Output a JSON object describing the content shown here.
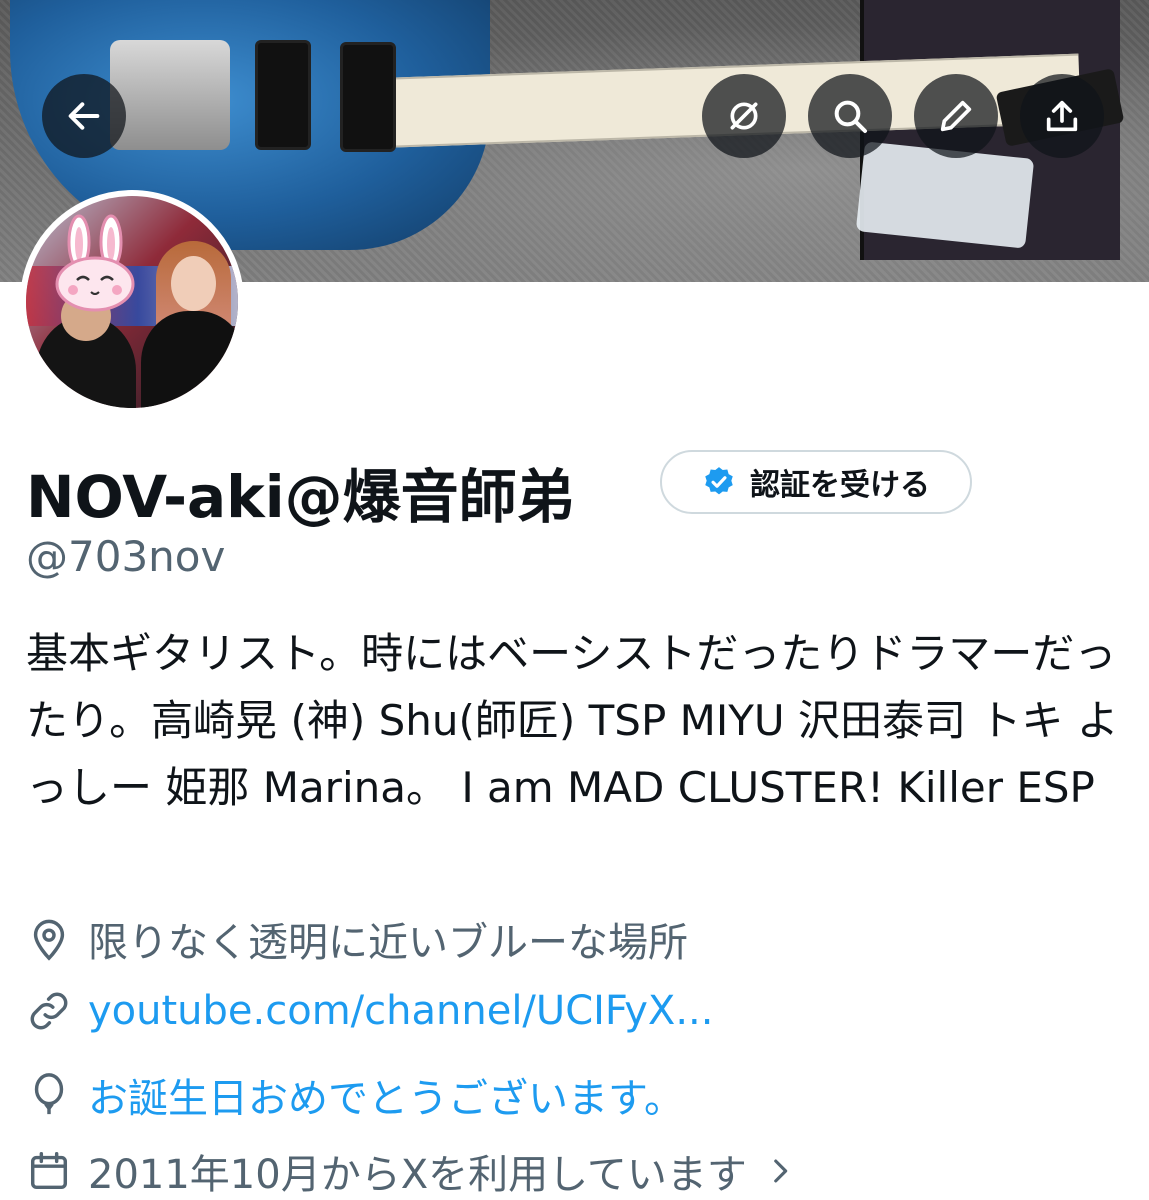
{
  "header": {
    "back_icon": "arrow-left-icon",
    "actions": [
      "hide-icon",
      "search-icon",
      "edit-icon",
      "share-icon"
    ]
  },
  "profile": {
    "display_name": "NOV-aki@爆音師弟",
    "handle": "@703nov",
    "verify_button_label": "認証を受ける",
    "bio": "基本ギタリスト。時にはベーシストだったりドラマーだったり。高崎晃 (神) Shu(師匠) TSP MIYU 沢田泰司 トキ よっしー 姫那 Marina。 I am MAD CLUSTER! Killer ESP",
    "location": "限りなく透明に近いブルーな場所",
    "website": "youtube.com/channel/UCIFyX...",
    "birthday": "お誕生日おめでとうございます。",
    "joined": "2011年10月からXを利用しています",
    "colors": {
      "link": "#1d9bf0",
      "secondary_text": "#536471",
      "verified": "#1d9bf0"
    }
  }
}
